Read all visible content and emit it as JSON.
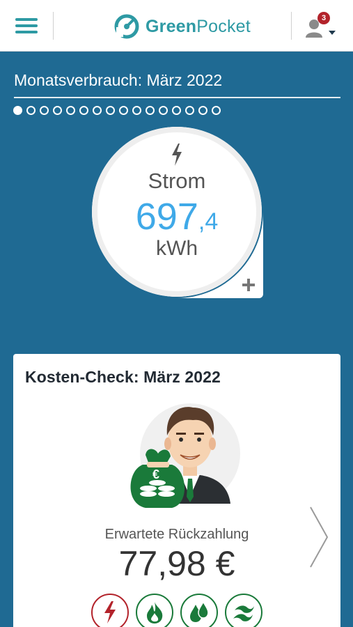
{
  "header": {
    "logo_text_bold": "Green",
    "logo_text_light": "Pocket",
    "notification_count": "3",
    "accent_color": "#2e9aa4"
  },
  "monthly": {
    "title": "Monatsverbrauch: März 2022",
    "page_count": 16,
    "active_page": 1,
    "energy_icon": "lightning-icon",
    "label": "Strom",
    "value_int": "697",
    "value_dec": ",4",
    "unit": "kWh",
    "value_color": "#3fa9e8"
  },
  "cost_check": {
    "title": "Kosten-Check: März 2022",
    "refund_label": "Erwartete Rückzahlung",
    "refund_value": "77,98 €",
    "energy_types": [
      {
        "icon": "lightning-icon",
        "color": "#b3232b"
      },
      {
        "icon": "flame-icon",
        "color": "#1a7a3a"
      },
      {
        "icon": "water-drops-icon",
        "color": "#1a7a3a"
      },
      {
        "icon": "gas-waves-icon",
        "color": "#1a7a3a"
      }
    ]
  }
}
